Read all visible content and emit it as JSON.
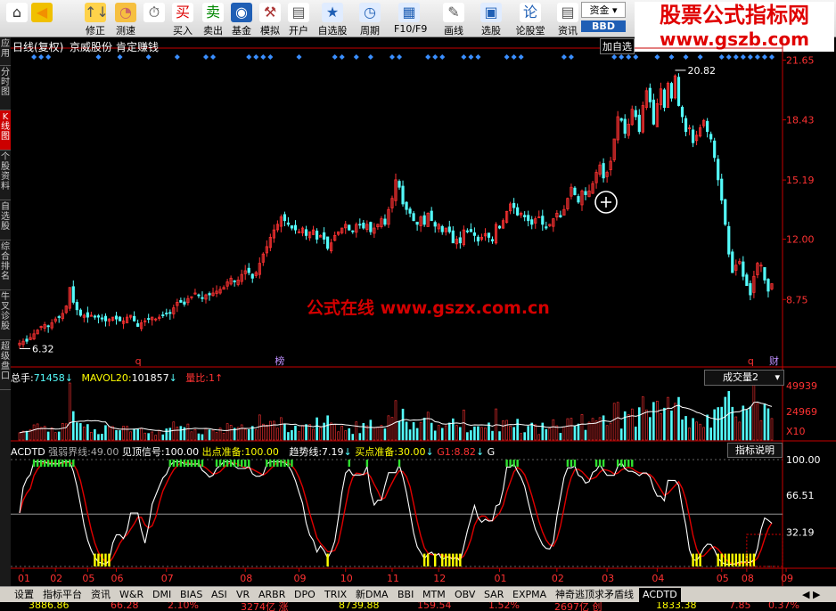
{
  "toolbar": {
    "buttons": [
      {
        "label": "",
        "icon": "⌂"
      },
      {
        "label": "",
        "icon": "◀"
      },
      {
        "label": "修正",
        "icon": "↑↓"
      },
      {
        "label": "测速",
        "icon": "◔"
      },
      {
        "label": "",
        "icon": "⏱"
      },
      {
        "label": "买入",
        "icon": "买"
      },
      {
        "label": "卖出",
        "icon": "卖"
      },
      {
        "label": "基金",
        "icon": "◉"
      },
      {
        "label": "模拟",
        "icon": "⚒"
      },
      {
        "label": "开户",
        "icon": "▤"
      },
      {
        "label": "自选股",
        "icon": "★"
      },
      {
        "label": "周期",
        "icon": "◷"
      },
      {
        "label": "F10/F9",
        "icon": "▦"
      },
      {
        "label": "画线",
        "icon": "✎"
      },
      {
        "label": "选股",
        "icon": "▣"
      },
      {
        "label": "论股堂",
        "icon": "论"
      },
      {
        "label": "资讯",
        "icon": "▤"
      }
    ],
    "fund_label": "资金",
    "bbd_label": "BBD"
  },
  "watermark": {
    "line1": "股票公式指标网",
    "line2": "www.gszb.com"
  },
  "center_watermark": "公式在线 www.gszx.com.cn",
  "sidebar": [
    {
      "label": "应用",
      "h": 32
    },
    {
      "label": "分时图",
      "h": 50
    },
    {
      "label": "K线图",
      "h": 45,
      "active": true
    },
    {
      "label": "个股资料",
      "h": 56
    },
    {
      "label": "自选股",
      "h": 45
    },
    {
      "label": "综合排名",
      "h": 56
    },
    {
      "label": "牛叉诊股",
      "h": 56
    },
    {
      "label": "超级盘口",
      "h": 56
    }
  ],
  "header": {
    "title": "日线(复权)",
    "stock": "京威股份",
    "formula": "肯定赚钱",
    "add_button": "加自选"
  },
  "price_axis": [
    "21.65",
    "18.43",
    "15.19",
    "12.00",
    "8.75"
  ],
  "price_annot": {
    "high": "20.82",
    "low": "6.32"
  },
  "event_marks": [
    {
      "i": 33,
      "text": "q"
    },
    {
      "i": 72,
      "text": "榜"
    },
    {
      "i": 204,
      "text": "q"
    },
    {
      "i": 210,
      "text": "财"
    }
  ],
  "volume": {
    "total_label": "总手:",
    "total_value": "71458",
    "ma_label": "MAVOL20:",
    "ma_value": "101857",
    "ratio_label": "量比:",
    "ratio_value": "1",
    "dropdown": "成交量2",
    "axis": [
      "49939",
      "24969",
      "X10"
    ]
  },
  "indicator": {
    "name": "ACDTD",
    "weak_label": "强弱界线:",
    "weak_value": "49.00",
    "peak_label": "见顶信号:",
    "peak_value": "100.00",
    "out_label": "出点准备:",
    "out_value": "100.00",
    "trend_label": "趋势线:",
    "trend_value": "7.19",
    "buy_label": "买点准备:",
    "buy_value": "30.00",
    "g1_label": "G1:",
    "g1_value": "8.82",
    "g_label": "G",
    "help_button": "指标说明",
    "axis": [
      "100.00",
      "66.51",
      "32.19"
    ]
  },
  "x_axis": [
    {
      "i": 1,
      "t": "01"
    },
    {
      "i": 10,
      "t": "02"
    },
    {
      "i": 19,
      "t": "05"
    },
    {
      "i": 27,
      "t": "06"
    },
    {
      "i": 41,
      "t": "07"
    },
    {
      "i": 63,
      "t": "08"
    },
    {
      "i": 78,
      "t": "09"
    },
    {
      "i": 91,
      "t": "10"
    },
    {
      "i": 104,
      "t": "11"
    },
    {
      "i": 117,
      "t": "12"
    },
    {
      "i": 134,
      "t": "01"
    },
    {
      "i": 150,
      "t": "02"
    },
    {
      "i": 164,
      "t": "03"
    },
    {
      "i": 178,
      "t": "04"
    },
    {
      "i": 196,
      "t": "05"
    },
    {
      "i": 203,
      "t": "08"
    },
    {
      "i": 214,
      "t": "09"
    }
  ],
  "tabs": [
    "设置",
    "指标平台",
    "资讯",
    "W&R",
    "DMI",
    "BIAS",
    "ASI",
    "VR",
    "ARBR",
    "DPO",
    "TRIX",
    "新DMA",
    "BBI",
    "MTM",
    "OBV",
    "SAR",
    "EXPMA",
    "神奇逃顶求矛盾线",
    "ACDTD"
  ],
  "active_tab": "ACDTD",
  "status": [
    "3886.86",
    "66.28",
    "2.10%",
    "3274亿 涨",
    "8739.88",
    "159.54",
    "1.52%",
    "2697亿 创",
    "1833.38",
    "7.85",
    "0.37%"
  ],
  "colors": {
    "up": "#ff3232",
    "down": "#54fcfc",
    "axis": "#c80000",
    "yellow": "#ffff00",
    "blue_mark": "#3a8fff"
  },
  "chart_data": {
    "type": "candlestick",
    "ylim": [
      5.5,
      22.2
    ],
    "close": [
      6.4,
      6.5,
      6.5,
      6.7,
      6.9,
      7.1,
      7.3,
      7.4,
      7.3,
      7.5,
      7.7,
      7.8,
      8,
      8.4,
      9.4,
      8.6,
      8.2,
      7.9,
      7.9,
      7.8,
      7.9,
      7.8,
      7.8,
      7.7,
      7.6,
      7.7,
      7.8,
      7.7,
      7.6,
      7.6,
      7.8,
      7.9,
      7.6,
      7.3,
      7.5,
      7.6,
      7.7,
      7.8,
      7.7,
      7.8,
      7.9,
      8.0,
      8.0,
      8.3,
      8.6,
      8.6,
      8.5,
      8.8,
      8.9,
      9.1,
      9.0,
      8.8,
      9.0,
      9.0,
      9.1,
      9.2,
      9.3,
      9.4,
      9.7,
      9.9,
      9.7,
      9.8,
      10.1,
      10.3,
      10.2,
      9.9,
      10.2,
      10.7,
      11.2,
      11.6,
      12.1,
      12.5,
      12.8,
      13.2,
      13.0,
      12.8,
      12.6,
      12.5,
      12.4,
      12.6,
      12.2,
      12.4,
      12.5,
      12.0,
      12.2,
      12.0,
      11.5,
      11.8,
      12.2,
      12.4,
      12.6,
      12.8,
      12.5,
      12.4,
      12.8,
      12.8,
      12.6,
      12.8,
      12.4,
      12.6,
      12.8,
      13.1,
      12.8,
      13.6,
      14.2,
      15.2,
      14.8,
      13.9,
      13.6,
      13.4,
      13.0,
      12.8,
      13.2,
      12.8,
      13.4,
      13.0,
      12.7,
      12.8,
      12.4,
      12.6,
      12.4,
      11.8,
      12.0,
      11.8,
      12.5,
      12.4,
      12.4,
      12.2,
      11.9,
      12.1,
      12.3,
      12.1,
      11.9,
      12.8,
      12.6,
      13.0,
      13.5,
      13.9,
      13.7,
      13.3,
      13.4,
      13.2,
      13.0,
      12.8,
      13.1,
      13.2,
      12.8,
      12.6,
      12.8,
      13.1,
      13.4,
      13.2,
      13.6,
      14.2,
      14.8,
      14.4,
      14.0,
      14.6,
      14.4,
      14.6,
      15.0,
      15.6,
      16.0,
      15.3,
      15.6,
      16.2,
      17.4,
      18.6,
      18.4,
      17.7,
      18.2,
      19.0,
      18.6,
      17.8,
      19.2,
      20.0,
      19.4,
      18.2,
      19.3,
      20.1,
      19.1,
      20.4,
      19.6,
      20.8,
      19.2,
      18.6,
      17.8,
      18.0,
      17.2,
      17.6,
      18.0,
      18.4,
      17.8,
      17.4,
      16.4,
      15.2,
      14.1,
      12.8,
      11.2,
      10.2,
      10.6,
      10.8,
      10.0,
      9.5,
      9.0,
      10.0,
      10.7,
      10.6,
      9.8,
      9.2,
      9.6
    ]
  }
}
